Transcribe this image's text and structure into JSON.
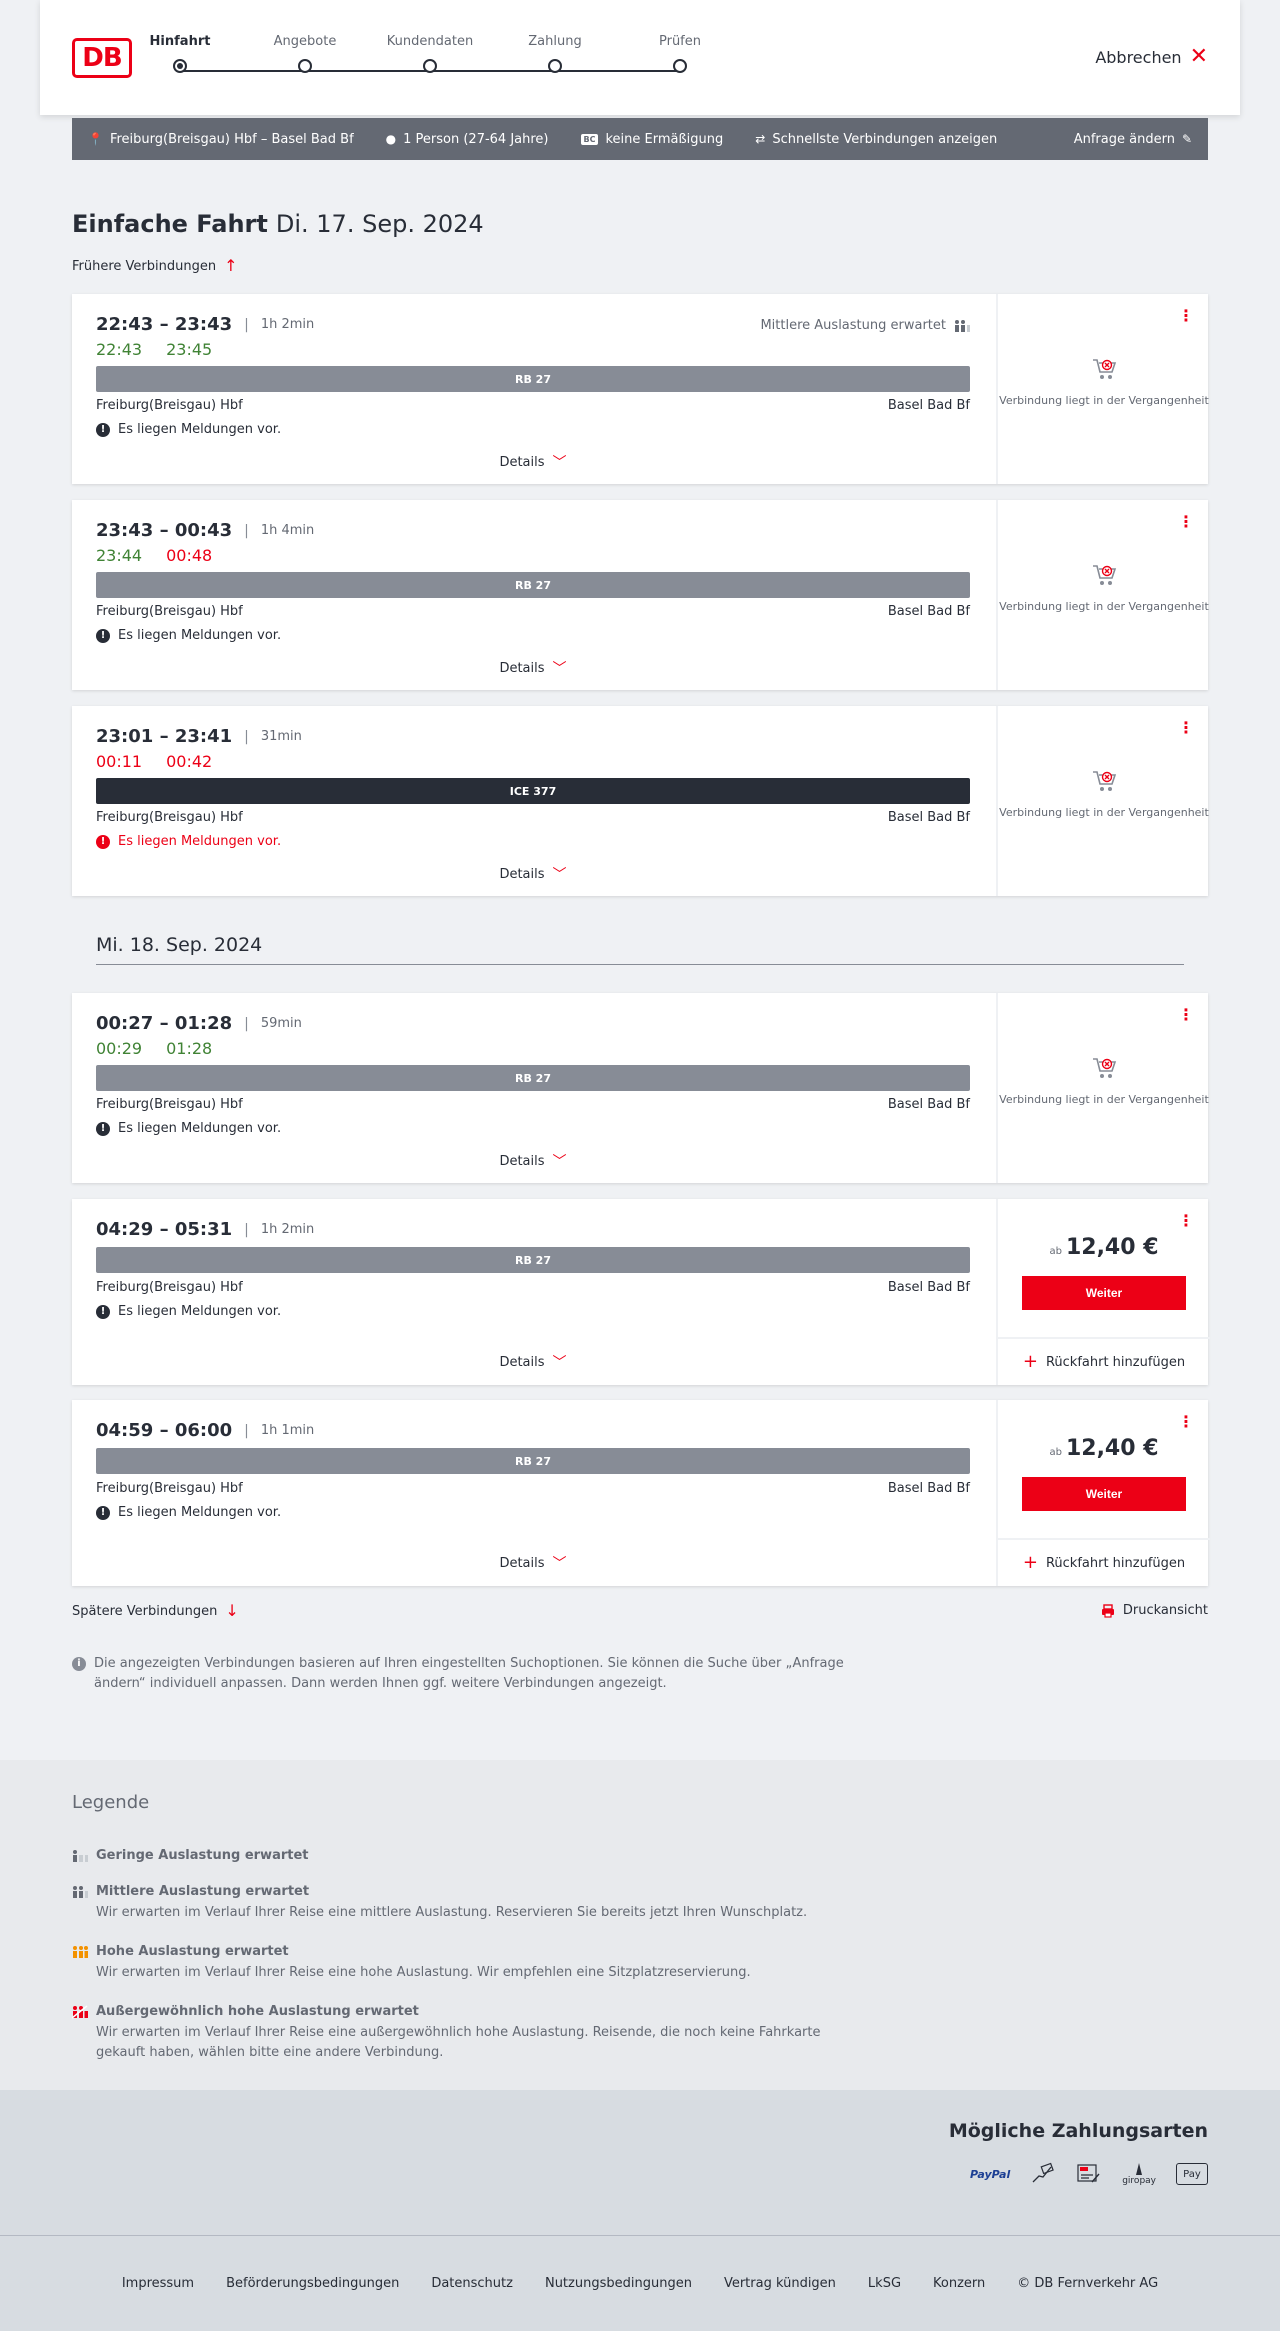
{
  "brand": {
    "logo_text": "DB"
  },
  "steps": [
    {
      "label": "Hinfahrt",
      "active": true
    },
    {
      "label": "Angebote",
      "active": false
    },
    {
      "label": "Kundendaten",
      "active": false
    },
    {
      "label": "Zahlung",
      "active": false
    },
    {
      "label": "Prüfen",
      "active": false
    }
  ],
  "header": {
    "abort_label": "Abbrechen"
  },
  "summary": {
    "route": "Freiburg(Breisgau) Hbf – Basel Bad Bf",
    "passengers": "1 Person (27-64 Jahre)",
    "discount_badge": "BC",
    "discount": "keine Ermäßigung",
    "fastest": "Schnellste Verbindungen anzeigen",
    "change": "Anfrage ändern"
  },
  "title": {
    "type": "Einfache Fahrt",
    "date": "Di. 17. Sep. 2024"
  },
  "earlier_label": "Frühere Verbindungen",
  "later_label": "Spätere Verbindungen",
  "print_label": "Druckansicht",
  "day2_label": "Mi. 18. Sep. 2024",
  "details_label": "Details",
  "past_text": "Verbindung liegt in der Vergangenheit",
  "price_prefix": "ab",
  "continue_label": "Weiter",
  "return_label": "Rückfahrt hinzufügen",
  "connections": [
    {
      "times": "22:43 – 23:43",
      "duration": "1h 2min",
      "rt_dep": "22:43",
      "rt_dep_status": "ontime",
      "rt_arr": "23:45",
      "rt_arr_status": "ontime",
      "load": "Mittlere Auslastung erwartet",
      "train": "RB 27",
      "from": "Freiburg(Breisgau) Hbf",
      "to": "Basel Bad Bf",
      "message": "Es liegen Meldungen vor.",
      "message_status": "normal"
    },
    {
      "times": "23:43 – 00:43",
      "duration": "1h 4min",
      "rt_dep": "23:44",
      "rt_dep_status": "ontime",
      "rt_arr": "00:48",
      "rt_arr_status": "late",
      "load": "",
      "train": "RB 27",
      "from": "Freiburg(Breisgau) Hbf",
      "to": "Basel Bad Bf",
      "message": "Es liegen Meldungen vor.",
      "message_status": "normal"
    },
    {
      "times": "23:01 – 23:41",
      "duration": "31min",
      "rt_dep": "00:11",
      "rt_dep_status": "late",
      "rt_arr": "00:42",
      "rt_arr_status": "late",
      "load": "",
      "train": "ICE 377",
      "from": "Freiburg(Breisgau) Hbf",
      "to": "Basel Bad Bf",
      "message": "Es liegen Meldungen vor.",
      "message_status": "warning"
    },
    {
      "times": "00:27 – 01:28",
      "duration": "59min",
      "rt_dep": "00:29",
      "rt_dep_status": "ontime",
      "rt_arr": "01:28",
      "rt_arr_status": "ontime",
      "load": "",
      "train": "RB 27",
      "from": "Freiburg(Breisgau) Hbf",
      "to": "Basel Bad Bf",
      "message": "Es liegen Meldungen vor.",
      "message_status": "normal"
    },
    {
      "times": "04:29 – 05:31",
      "duration": "1h 2min",
      "train": "RB 27",
      "from": "Freiburg(Breisgau) Hbf",
      "to": "Basel Bad Bf",
      "message": "Es liegen Meldungen vor.",
      "price": "12,40 €"
    },
    {
      "times": "04:59 – 06:00",
      "duration": "1h 1min",
      "train": "RB 27",
      "from": "Freiburg(Breisgau) Hbf",
      "to": "Basel Bad Bf",
      "message": "Es liegen Meldungen vor.",
      "price": "12,40 €"
    }
  ],
  "info_text": "Die angezeigten Verbindungen basieren auf Ihren eingestellten Suchoptionen. Sie können die Suche über „Anfrage ändern“ individuell anpassen. Dann werden Ihnen ggf. weitere Verbindungen angezeigt.",
  "legend": {
    "title": "Legende",
    "items": [
      {
        "head": "Geringe Auslastung erwartet",
        "text": ""
      },
      {
        "head": "Mittlere Auslastung erwartet",
        "text": "Wir erwarten im Verlauf Ihrer Reise eine mittlere Auslastung. Reservieren Sie bereits jetzt Ihren Wunschplatz."
      },
      {
        "head": "Hohe Auslastung erwartet",
        "text": "Wir erwarten im Verlauf Ihrer Reise eine hohe Auslastung. Wir empfehlen eine Sitzplatzreservierung."
      },
      {
        "head": "Außergewöhnlich hohe Auslastung erwartet",
        "text": "Wir erwarten im Verlauf Ihrer Reise eine außergewöhnlich hohe Auslastung. Reisende, die noch keine Fahrkarte gekauft haben, wählen bitte eine andere Verbindung."
      }
    ]
  },
  "payment": {
    "title": "Mögliche Zahlungsarten",
    "logos": [
      "PayPal",
      "giropay",
      "Pay"
    ]
  },
  "footer": [
    "Impressum",
    "Beförderungsbedingungen",
    "Datenschutz",
    "Nutzungsbedingungen",
    "Vertrag kündigen",
    "LkSG",
    "Konzern",
    "© DB Fernverkehr AG"
  ],
  "colors": {
    "brand_red": "#ec0016",
    "ontime_green": "#408335",
    "bar_grey": "#878c96",
    "ice_dark": "#282d37",
    "summary_bg": "#646973"
  }
}
